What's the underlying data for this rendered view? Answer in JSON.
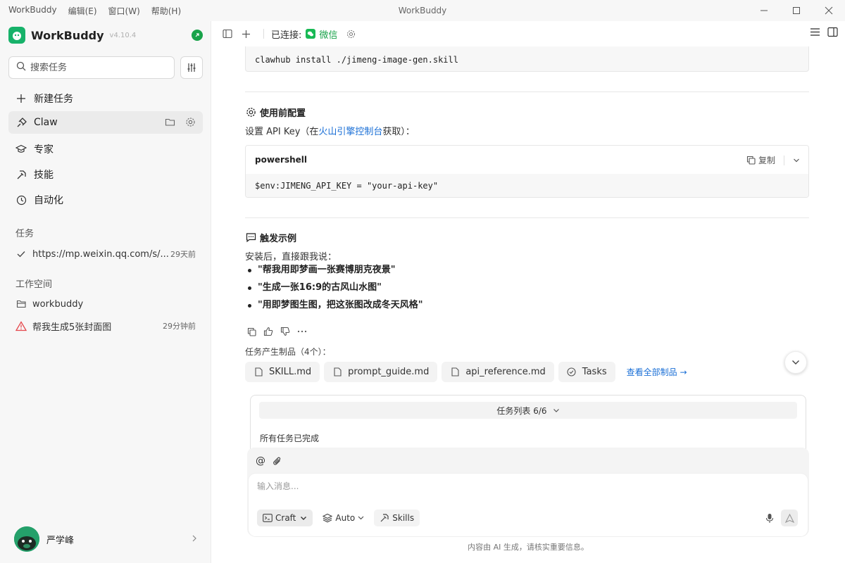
{
  "window": {
    "title": "WorkBuddy",
    "menu": [
      "WorkBuddy",
      "编辑(E)",
      "窗口(W)",
      "帮助(H)"
    ]
  },
  "sidebar": {
    "brand_name": "WorkBuddy",
    "version": "v4.10.4",
    "search_placeholder": "搜索任务",
    "nav": [
      {
        "label": "新建任务",
        "icon": "plus-icon"
      },
      {
        "label": "Claw",
        "icon": "claw-icon"
      },
      {
        "label": "专家",
        "icon": "graduation-cap-icon"
      },
      {
        "label": "技能",
        "icon": "skills-icon"
      },
      {
        "label": "自动化",
        "icon": "clock-icon"
      }
    ],
    "tasks_heading": "任务",
    "tasks": [
      {
        "title": "https://mp.weixin.qq.com/s/...",
        "time": "29天前"
      }
    ],
    "workspace_heading": "工作空间",
    "workspace": [
      {
        "title": "workbuddy"
      },
      {
        "title": "帮我生成5张封面图",
        "time": "29分钟前"
      }
    ],
    "user_name": "严学峰"
  },
  "toolbar": {
    "connected_label": "已连接:",
    "channel": "微信"
  },
  "main": {
    "install_cmd": "clawhub install ./jimeng-image-gen.skill",
    "config_heading": "使用前配置",
    "config_text_pre": "设置 API Key（在",
    "config_link": "火山引擎控制台",
    "config_text_post": "获取）：",
    "code_lang": "powershell",
    "copy_label": "复制",
    "code_line": "$env:JIMENG_API_KEY = \"your-api-key\"",
    "trigger_heading": "触发示例",
    "trigger_intro": "安装后，直接跟我说：",
    "examples": [
      "\"帮我用即梦画一张赛博朋克夜景\"",
      "\"生成一张16:9的古风山水图\"",
      "\"用即梦图生图，把这张图改成冬天风格\""
    ],
    "artifacts_label": "任务产生制品（4个）：",
    "artifacts": [
      "SKILL.md",
      "prompt_guide.md",
      "api_reference.md",
      "Tasks"
    ],
    "view_all": "查看全部制品 →",
    "task_list_title": "任务列表 6/6",
    "task_status": "所有任务已完成"
  },
  "composer": {
    "placeholder": "输入消息...",
    "mode": "Craft",
    "model": "Auto",
    "skills": "Skills",
    "disclaimer": "内容由 AI 生成，请核实重要信息。"
  },
  "colors": {
    "brand": "#17b26a",
    "link": "#1a6fd6",
    "wechat": "#19a34a"
  }
}
